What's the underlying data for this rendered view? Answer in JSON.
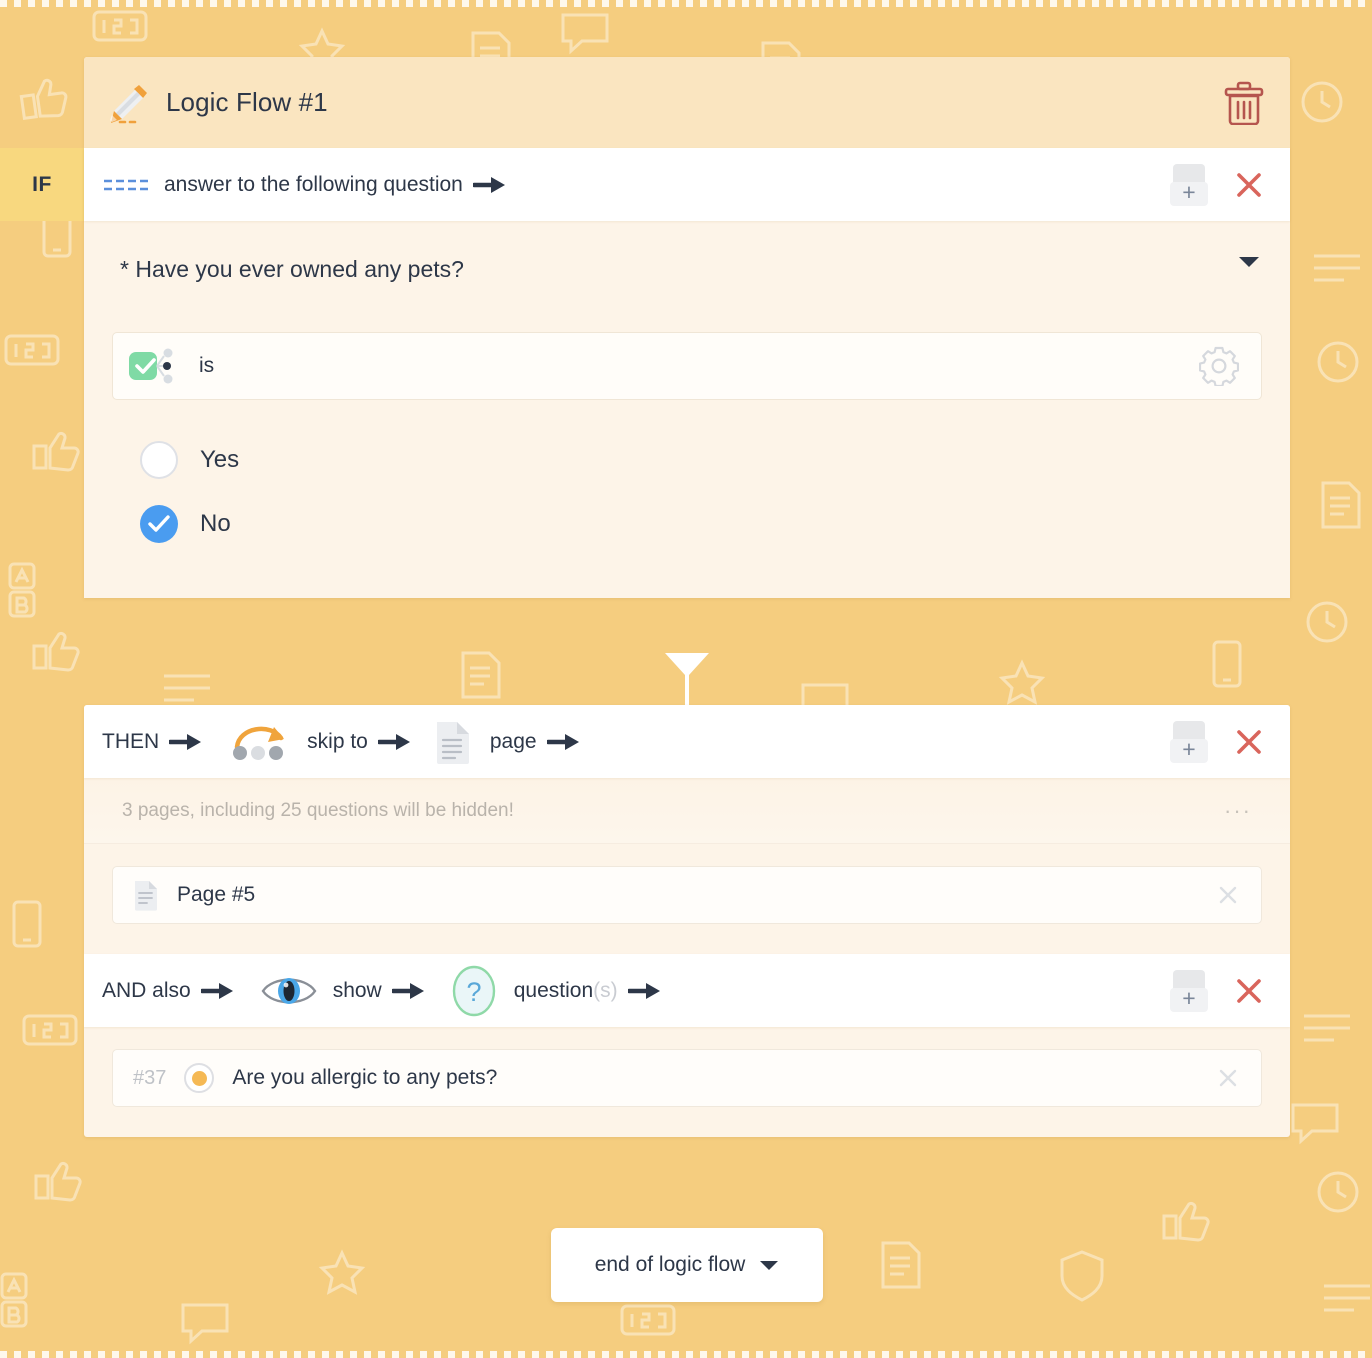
{
  "header": {
    "title": "Logic Flow #1",
    "pencil_icon": "pencil-icon",
    "delete_icon": "trash-icon"
  },
  "if_block": {
    "badge": "IF",
    "condition_bar": {
      "dots_icon": "dashed-lines-icon",
      "label": "answer to the following question",
      "arrow_icon": "arrow-right-icon",
      "add_label": "+",
      "remove_icon": "close-icon"
    },
    "question": {
      "required_marker": "*",
      "text": "Have you ever owned any pets?",
      "caret_icon": "chevron-down-icon"
    },
    "operator": {
      "icon": "checkbox-condition-icon",
      "label": "is",
      "settings_icon": "gear-icon"
    },
    "choices": [
      {
        "label": "Yes",
        "selected": false
      },
      {
        "label": "No",
        "selected": true
      }
    ]
  },
  "then_block": {
    "bar": {
      "keyword": "THEN",
      "action_icon": "skip-dots-icon",
      "action_label": "skip to",
      "target_icon": "page-document-icon",
      "target_label": "page",
      "arrow_icon": "arrow-right-icon",
      "add_label": "+",
      "remove_icon": "close-icon"
    },
    "note": "3 pages, including 25 questions will be hidden!",
    "note_menu": "···",
    "item": {
      "icon": "page-document-icon",
      "label": "Page #5",
      "remove_icon": "close-icon"
    }
  },
  "and_block": {
    "bar": {
      "keyword": "AND also",
      "action_icon": "eye-icon",
      "action_label": "show",
      "target_icon": "question-mark-icon",
      "target_label": "question",
      "target_label_suffix": "(s)",
      "arrow_icon": "arrow-right-icon",
      "add_label": "+",
      "remove_icon": "close-icon"
    },
    "item": {
      "number": "#37",
      "icon": "orange-radio-icon",
      "label": "Are you allergic to any pets?",
      "remove_icon": "close-icon"
    }
  },
  "footer": {
    "end_label": "end of logic flow",
    "caret_icon": "chevron-down-icon"
  },
  "colors": {
    "background": "#f5cd7f",
    "header_bar": "#fae5c0",
    "panel_body": "#fdf4e8",
    "if_badge": "#f8d87f",
    "accent_blue": "#4a9cf0",
    "accent_green": "#7fdaa5",
    "accent_orange": "#f5b955",
    "danger_red": "#d9534f",
    "text_dark": "#2d3748",
    "text_muted": "#b9b3ab"
  }
}
